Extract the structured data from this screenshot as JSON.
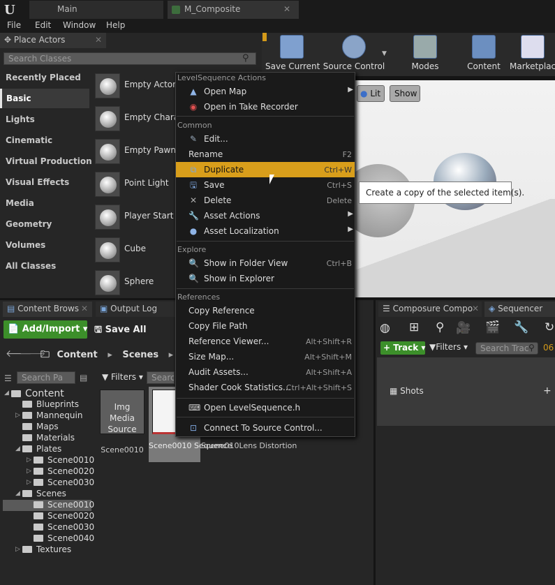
{
  "app": {
    "logo": "U"
  },
  "tabs": [
    {
      "label": "Main"
    },
    {
      "label": "M_Composite"
    }
  ],
  "menu": [
    "File",
    "Edit",
    "Window",
    "Help"
  ],
  "place_actors": {
    "title": "Place Actors",
    "search_placeholder": "Search Classes",
    "categories": [
      "Recently Placed",
      "Basic",
      "Lights",
      "Cinematic",
      "Virtual Production",
      "Visual Effects",
      "Media",
      "Geometry",
      "Volumes",
      "All Classes"
    ],
    "selected_category": "Basic",
    "actors": [
      "Empty Actor",
      "Empty Chara",
      "Empty Pawn",
      "Point Light",
      "Player Start",
      "Cube",
      "Sphere"
    ]
  },
  "toolbar": {
    "save_current": "Save Current",
    "source_control": "Source Control",
    "modes": "Modes",
    "content": "Content",
    "marketplace": "Marketplace"
  },
  "viewport": {
    "lit": "Lit",
    "show": "Show"
  },
  "context_menu": {
    "sections": [
      "LevelSequence Actions",
      "Common",
      "Explore",
      "References"
    ],
    "level_items": [
      {
        "label": "Open Map",
        "icon": "open-map-icon"
      },
      {
        "label": "Open in Take Recorder",
        "icon": "record-icon"
      }
    ],
    "common_items": [
      {
        "label": "Edit...",
        "key": ""
      },
      {
        "label": "Rename",
        "key": "F2"
      },
      {
        "label": "Duplicate",
        "key": "Ctrl+W"
      },
      {
        "label": "Save",
        "key": "Ctrl+S"
      },
      {
        "label": "Delete",
        "key": "Delete"
      },
      {
        "label": "Asset Actions",
        "key": ""
      },
      {
        "label": "Asset Localization",
        "key": ""
      }
    ],
    "explore_items": [
      {
        "label": "Show in Folder View",
        "key": "Ctrl+B"
      },
      {
        "label": "Show in Explorer",
        "key": ""
      }
    ],
    "reference_items": [
      {
        "label": "Copy Reference",
        "key": ""
      },
      {
        "label": "Copy File Path",
        "key": ""
      },
      {
        "label": "Reference Viewer...",
        "key": "Alt+Shift+R"
      },
      {
        "label": "Size Map...",
        "key": "Alt+Shift+M"
      },
      {
        "label": "Audit Assets...",
        "key": "Alt+Shift+A"
      },
      {
        "label": "Shader Cook Statistics...",
        "key": "Ctrl+Alt+Shift+S"
      }
    ],
    "open_header": "Open LevelSequence.h",
    "connect": "Connect To Source Control..."
  },
  "tooltip": "Create a copy of the selected item(s).",
  "content_browser": {
    "tab": "Content Brows",
    "output_log": "Output Log",
    "add_import": "Add/Import",
    "save_all": "Save All",
    "path": [
      "Content",
      "Scenes"
    ],
    "search_paths": "Search Pa",
    "filters": "Filters",
    "search_assets": "Search",
    "tree": [
      {
        "label": "Content",
        "depth": 0,
        "exp": "open"
      },
      {
        "label": "Blueprints",
        "depth": 1,
        "exp": ""
      },
      {
        "label": "Mannequin",
        "depth": 1,
        "exp": "closed"
      },
      {
        "label": "Maps",
        "depth": 1,
        "exp": ""
      },
      {
        "label": "Materials",
        "depth": 1,
        "exp": ""
      },
      {
        "label": "Plates",
        "depth": 1,
        "exp": "open"
      },
      {
        "label": "Scene0010",
        "depth": 2,
        "exp": "closed"
      },
      {
        "label": "Scene0020",
        "depth": 2,
        "exp": "closed"
      },
      {
        "label": "Scene0030",
        "depth": 2,
        "exp": "closed"
      },
      {
        "label": "Scenes",
        "depth": 1,
        "exp": "open"
      },
      {
        "label": "Scene0010",
        "depth": 2,
        "exp": ""
      },
      {
        "label": "Scene0020",
        "depth": 2,
        "exp": ""
      },
      {
        "label": "Scene0030",
        "depth": 2,
        "exp": ""
      },
      {
        "label": "Scene0040",
        "depth": 2,
        "exp": ""
      },
      {
        "label": "Textures",
        "depth": 1,
        "exp": "closed"
      }
    ],
    "selected_tree": "Scene0010",
    "assets": [
      {
        "thumb_text": "Img Media Source",
        "label": "Scene0010"
      },
      {
        "thumb_text": "",
        "label": "Scene0010 Sequence"
      },
      {
        "thumb_text": "",
        "label": "Scene010Lens Distortion"
      }
    ]
  },
  "sequencer": {
    "composure_tab": "Composure Compo",
    "tab": "Sequencer",
    "track": "Track",
    "filters": "Filters",
    "search": "Search Trac",
    "time": "06",
    "shots": "Shots"
  }
}
